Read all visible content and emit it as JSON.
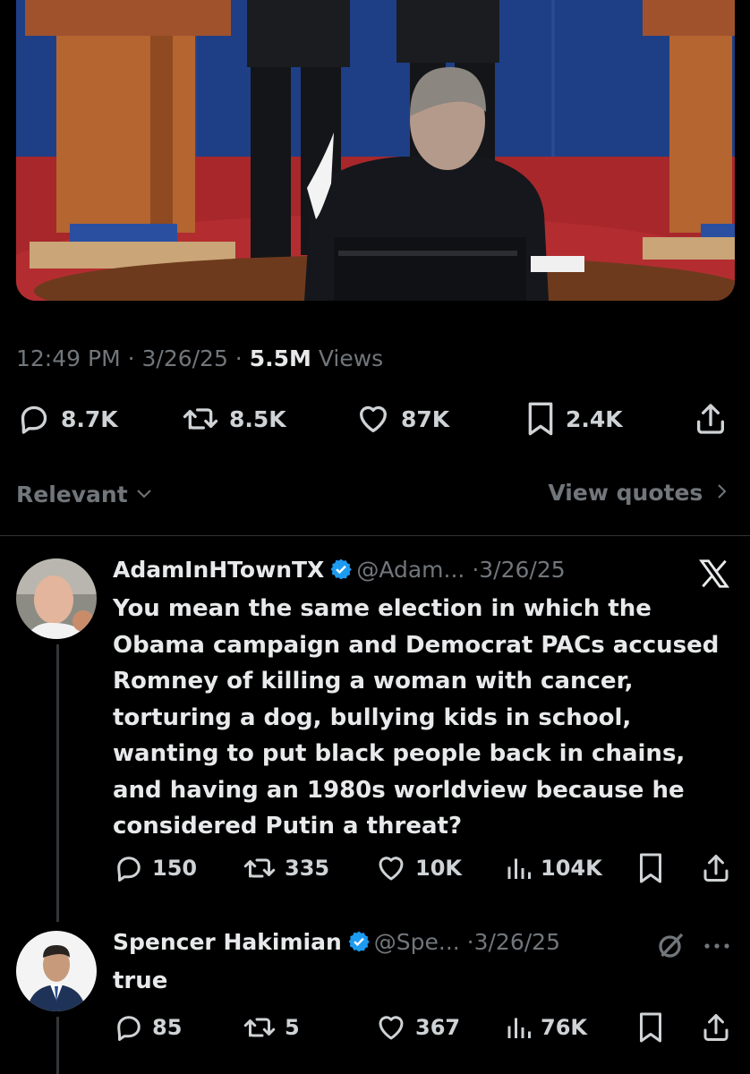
{
  "post": {
    "time": "12:49 PM",
    "sep1": " · ",
    "date": "3/26/25",
    "sep2": " · ",
    "views_count": "5.5M",
    "views_label": "Views",
    "replies": "8.7K",
    "reposts": "8.5K",
    "likes": "87K",
    "bookmarks": "2.4K"
  },
  "sort": {
    "relevant_label": "Relevant",
    "view_quotes_label": "View quotes"
  },
  "replies": [
    {
      "name": "AdamInHTownTX",
      "handle": "@Adam... ·3/26/25",
      "text": "You mean the same election in which the Obama campaign and Democrat PACs accused Romney of killing a woman with cancer, torturing a dog, bullying kids in school, wanting to put black people back in chains, and having an 1980s worldview because he considered Putin a threat?",
      "replies": "150",
      "reposts": "335",
      "likes": "10K",
      "views": "104K",
      "badge_icon": "x-logo-icon"
    },
    {
      "name": "Spencer Hakimian",
      "handle": "@Spe... ·3/26/25",
      "text": "true",
      "replies": "85",
      "reposts": "5",
      "likes": "367",
      "views": "76K",
      "badge_icon": "grok-icon"
    }
  ],
  "colors": {
    "background": "#000000",
    "text": "#e7e9ea",
    "secondary": "#71767b",
    "verified": "#1d9bf0",
    "divider": "#2f3336"
  }
}
